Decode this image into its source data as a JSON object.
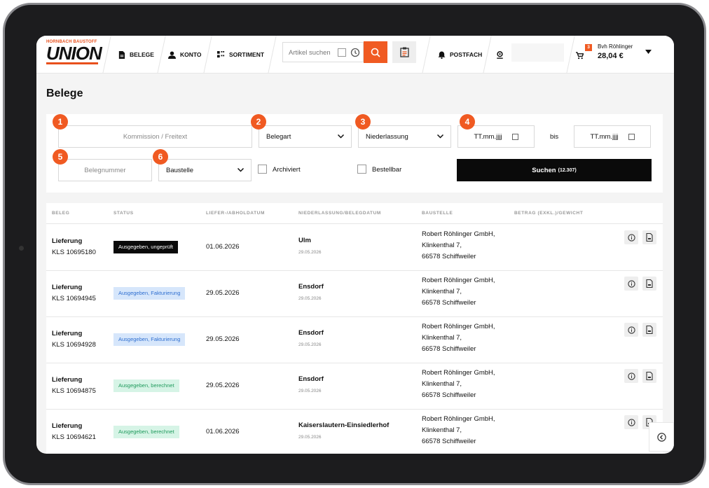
{
  "header": {
    "logo_top": "HORNBACH BAUSTOFF",
    "logo_word": "UNION",
    "nav": [
      {
        "label": "BELEGE",
        "icon": "document-icon"
      },
      {
        "label": "KONTO",
        "icon": "user-icon"
      },
      {
        "label": "SORTIMENT",
        "icon": "grid-icon"
      }
    ],
    "search_placeholder": "Artikel suchen",
    "postfach_label": "POSTFACH",
    "cart_count": "3",
    "account_name": "Bvh Röhlinger",
    "account_amount": "28,04 €"
  },
  "page": {
    "title": "Belege"
  },
  "filters": {
    "kommission_placeholder": "Kommission / Freitext",
    "belegart_label": "Belegart",
    "niederlassung_label": "Niederlassung",
    "date_from_placeholder": "TT.mm.jjjj",
    "bis_label": "bis",
    "date_to_placeholder": "TT.mm.jjjj",
    "belegnummer_placeholder": "Belegnummer",
    "baustelle_label": "Baustelle",
    "archiviert_label": "Archiviert",
    "bestellbar_label": "Bestellbar",
    "suchen_label": "Suchen",
    "suchen_count": "(12.307)",
    "badges": [
      "1",
      "2",
      "3",
      "4",
      "5",
      "6"
    ]
  },
  "table": {
    "columns": [
      "BELEG",
      "STATUS",
      "LIEFER-/ABHOLDATUM",
      "NIEDERLASSUNG/BELEGDATUM",
      "BAUSTELLE",
      "BETRAG (EXKL.)/GEWICHT"
    ],
    "rows": [
      {
        "type": "Lieferung",
        "number": "KLS 10695180",
        "status": "Ausgegeben, ungeprüft",
        "status_style": "dark",
        "date": "01.06.2026",
        "branch": "Ulm",
        "beleg_date": "29.05.2026",
        "site_line1": "Robert Röhlinger GmbH,",
        "site_line2": "Klinkenthal 7,",
        "site_line3": "66578 Schiffweiler"
      },
      {
        "type": "Lieferung",
        "number": "KLS 10694945",
        "status": "Ausgegeben, Fakturierung",
        "status_style": "blue",
        "date": "29.05.2026",
        "branch": "Ensdorf",
        "beleg_date": "29.05.2026",
        "site_line1": "Robert Röhlinger GmbH,",
        "site_line2": "Klinkenthal 7,",
        "site_line3": "66578 Schiffweiler"
      },
      {
        "type": "Lieferung",
        "number": "KLS 10694928",
        "status": "Ausgegeben, Fakturierung",
        "status_style": "blue",
        "date": "29.05.2026",
        "branch": "Ensdorf",
        "beleg_date": "29.05.2026",
        "site_line1": "Robert Röhlinger GmbH,",
        "site_line2": "Klinkenthal 7,",
        "site_line3": "66578 Schiffweiler"
      },
      {
        "type": "Lieferung",
        "number": "KLS 10694875",
        "status": "Ausgegeben, berechnet",
        "status_style": "green",
        "date": "29.05.2026",
        "branch": "Ensdorf",
        "beleg_date": "29.05.2026",
        "site_line1": "Robert Röhlinger GmbH,",
        "site_line2": "Klinkenthal 7,",
        "site_line3": "66578 Schiffweiler"
      },
      {
        "type": "Lieferung",
        "number": "KLS 10694621",
        "status": "Ausgegeben, berechnet",
        "status_style": "green",
        "date": "01.06.2026",
        "branch": "Kaiserslautern-Einsiedlerhof",
        "beleg_date": "29.05.2026",
        "site_line1": "Robert Röhlinger GmbH,",
        "site_line2": "Klinkenthal 7,",
        "site_line3": "66578 Schiffweiler"
      }
    ]
  },
  "colors": {
    "accent": "#f05a22",
    "status_dark": "#0a0a0a",
    "status_blue_bg": "#d6e6fb",
    "status_blue_fg": "#2f6fd0",
    "status_green_bg": "#d6f4e6",
    "status_green_fg": "#1f9a5c"
  }
}
